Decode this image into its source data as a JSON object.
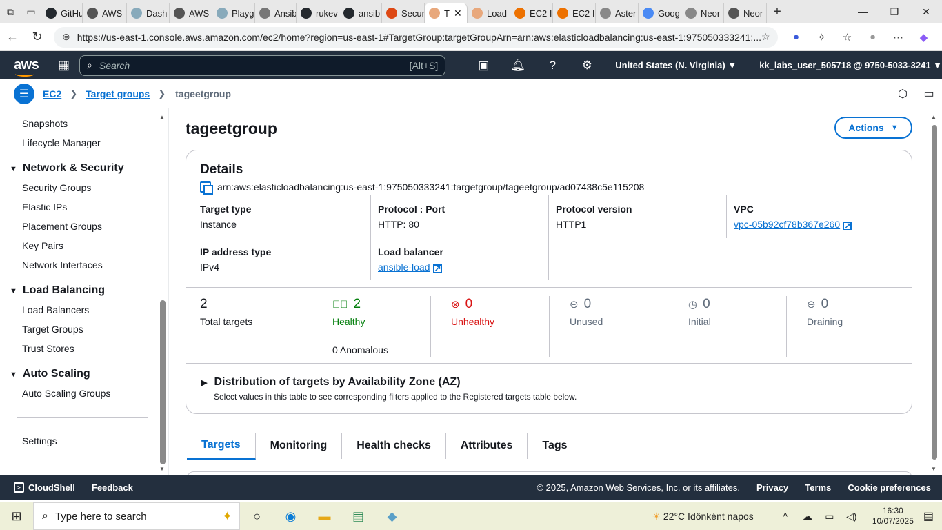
{
  "browser": {
    "tabs": [
      {
        "label": "GitHu",
        "color": "#24292e"
      },
      {
        "label": "AWS",
        "color": "#555"
      },
      {
        "label": "Dash",
        "color": "#8ab"
      },
      {
        "label": "AWS",
        "color": "#555"
      },
      {
        "label": "Playg",
        "color": "#8ab"
      },
      {
        "label": "Ansib",
        "color": "#777"
      },
      {
        "label": "rukev",
        "color": "#24292e"
      },
      {
        "label": "ansib",
        "color": "#24292e"
      },
      {
        "label": "Secur",
        "color": "#dd4814"
      },
      {
        "label": "T",
        "color": "#e8a87c",
        "active": true
      },
      {
        "label": "Load",
        "color": "#e8a87c"
      },
      {
        "label": "EC2 I",
        "color": "#ed7100"
      },
      {
        "label": "EC2 I",
        "color": "#ed7100"
      },
      {
        "label": "Aster",
        "color": "#888"
      },
      {
        "label": "Goog",
        "color": "#4a8af4"
      },
      {
        "label": "Neor",
        "color": "#888"
      },
      {
        "label": "Neor",
        "color": "#555"
      }
    ],
    "url": "https://us-east-1.console.aws.amazon.com/ec2/home?region=us-east-1#TargetGroup:targetGroupArn=arn:aws:elasticloadbalancing:us-east-1:975050333241:..."
  },
  "awsnav": {
    "logo": "aws",
    "search_placeholder": "Search",
    "search_hint": "[Alt+S]",
    "region": "United States (N. Virginia)",
    "account": "kk_labs_user_505718 @ 9750-5033-3241"
  },
  "breadcrumb": {
    "items": [
      "EC2",
      "Target groups"
    ],
    "current": "tageetgroup"
  },
  "sidebar": {
    "items_top": [
      "Snapshots",
      "Lifecycle Manager"
    ],
    "sections": [
      {
        "title": "Network & Security",
        "items": [
          "Security Groups",
          "Elastic IPs",
          "Placement Groups",
          "Key Pairs",
          "Network Interfaces"
        ]
      },
      {
        "title": "Load Balancing",
        "items": [
          "Load Balancers",
          "Target Groups",
          "Trust Stores"
        ]
      },
      {
        "title": "Auto Scaling",
        "items": [
          "Auto Scaling Groups"
        ]
      }
    ],
    "settings": "Settings"
  },
  "page": {
    "title": "tageetgroup",
    "actions_label": "Actions"
  },
  "details": {
    "title": "Details",
    "arn": "arn:aws:elasticloadbalancing:us-east-1:975050333241:targetgroup/tageetgroup/ad07438c5e115208",
    "target_type_label": "Target type",
    "target_type": "Instance",
    "protocol_port_label": "Protocol : Port",
    "protocol_port": "HTTP: 80",
    "protocol_version_label": "Protocol version",
    "protocol_version": "HTTP1",
    "vpc_label": "VPC",
    "vpc": "vpc-05b92cf78b367e260",
    "ip_type_label": "IP address type",
    "ip_type": "IPv4",
    "lb_label": "Load balancer",
    "lb": "ansible-load"
  },
  "stats": {
    "total": {
      "value": "2",
      "label": "Total targets"
    },
    "healthy": {
      "value": "2",
      "label": "Healthy"
    },
    "anomalous": "0 Anomalous",
    "unhealthy": {
      "value": "0",
      "label": "Unhealthy"
    },
    "unused": {
      "value": "0",
      "label": "Unused"
    },
    "initial": {
      "value": "0",
      "label": "Initial"
    },
    "draining": {
      "value": "0",
      "label": "Draining"
    }
  },
  "distribution": {
    "title": "Distribution of targets by Availability Zone (AZ)",
    "subtitle": "Select values in this table to see corresponding filters applied to the Registered targets table below."
  },
  "tabs": [
    "Targets",
    "Monitoring",
    "Health checks",
    "Attributes",
    "Tags"
  ],
  "footer": {
    "cloudshell": "CloudShell",
    "feedback": "Feedback",
    "copyright": "© 2025, Amazon Web Services, Inc. or its affiliates.",
    "privacy": "Privacy",
    "terms": "Terms",
    "cookies": "Cookie preferences"
  },
  "taskbar": {
    "search_placeholder": "Type here to search",
    "weather": "22°C  Időnként napos",
    "time": "16:30",
    "date": "10/07/2025"
  }
}
